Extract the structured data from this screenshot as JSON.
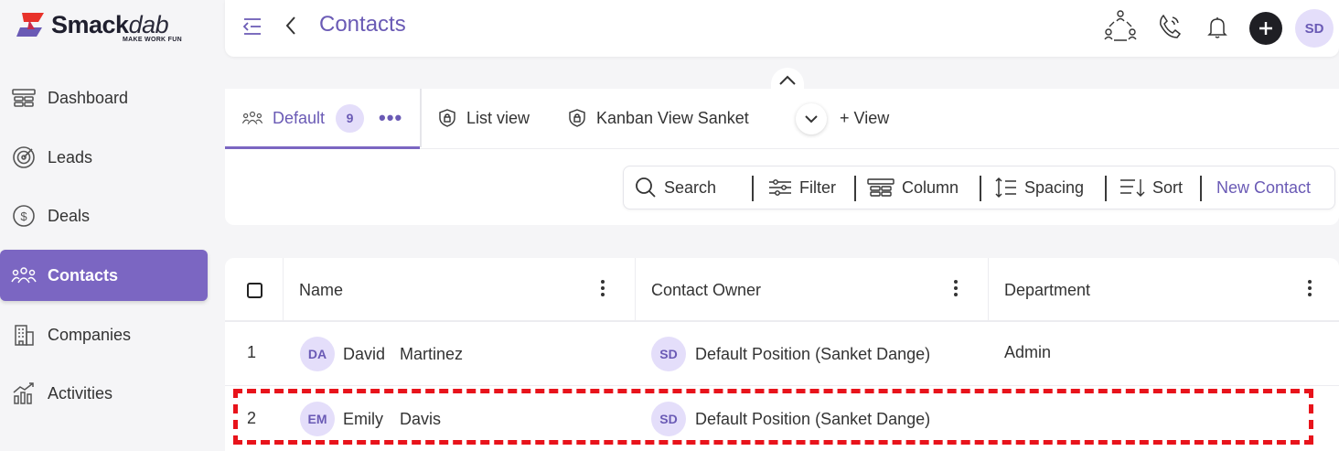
{
  "brand": {
    "name_bold": "Smack",
    "name_light": "dab",
    "tagline": "MAKE WORK FUN"
  },
  "sidebar": {
    "items": [
      {
        "label": "Dashboard",
        "icon": "dashboard-icon",
        "active": false
      },
      {
        "label": "Leads",
        "icon": "target-icon",
        "active": false
      },
      {
        "label": "Deals",
        "icon": "dollar-circle-icon",
        "active": false
      },
      {
        "label": "Contacts",
        "icon": "people-icon",
        "active": true
      },
      {
        "label": "Companies",
        "icon": "building-icon",
        "active": false
      },
      {
        "label": "Activities",
        "icon": "activity-chart-icon",
        "active": false
      }
    ]
  },
  "header": {
    "title": "Contacts",
    "avatar_initials": "SD"
  },
  "views": {
    "tabs": [
      {
        "label": "Default",
        "count": "9",
        "active": true
      },
      {
        "label": "List view",
        "active": false
      },
      {
        "label": "Kanban View Sanket",
        "active": false
      }
    ],
    "add_view_label": "+ View"
  },
  "toolbar": {
    "search_label": "Search",
    "filter_label": "Filter",
    "column_label": "Column",
    "spacing_label": "Spacing",
    "sort_label": "Sort",
    "new_contact_label": "New Contact"
  },
  "table": {
    "columns": [
      "Name",
      "Contact Owner",
      "Department"
    ],
    "rows": [
      {
        "index": "1",
        "initials": "DA",
        "first": "David",
        "last": "Martinez",
        "owner_initials": "SD",
        "owner": "Default Position (Sanket Dange)",
        "department": "Admin"
      },
      {
        "index": "2",
        "initials": "EM",
        "first": "Emily",
        "last": "Davis",
        "owner_initials": "SD",
        "owner": "Default Position (Sanket Dange)",
        "department": ""
      }
    ]
  },
  "colors": {
    "accent": "#7b66c2",
    "accent_text": "#6a5ab5",
    "highlight": "#e8131b"
  }
}
